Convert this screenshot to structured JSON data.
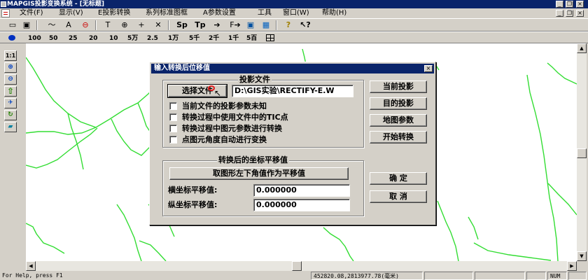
{
  "window": {
    "title": "MAPGIS投影变换系统 - [无标题]",
    "controls": [
      "_",
      "❐",
      "×"
    ]
  },
  "menubar": {
    "items": [
      "文件(F)",
      "显示(V)",
      "E投影转换",
      "系列标准图框",
      "A参数设置",
      "工具",
      "窗口(W)",
      "帮助(H)"
    ],
    "mdi_controls": [
      "_",
      "❐",
      "×"
    ]
  },
  "toolbar1": {
    "buttons": [
      {
        "icon": "new-file-icon",
        "glyph": "▭"
      },
      {
        "icon": "save-icon",
        "glyph": "▣"
      },
      {
        "icon": "polyline-icon",
        "glyph": "〜"
      },
      {
        "icon": "text-icon",
        "glyph": "A"
      },
      {
        "icon": "polygon-icon",
        "glyph": "⊖"
      },
      {
        "icon": "projection-t-icon",
        "glyph": "T"
      },
      {
        "icon": "crosshair-icon",
        "glyph": "⊕"
      },
      {
        "icon": "plus-icon",
        "glyph": "+"
      },
      {
        "icon": "x-cross-icon",
        "glyph": "✕"
      },
      {
        "icon": "sp-icon",
        "glyph": "Sp"
      },
      {
        "icon": "tp-icon",
        "glyph": "Tp"
      },
      {
        "icon": "arrow-right-icon",
        "glyph": "➔"
      },
      {
        "icon": "f-arrow-icon",
        "glyph": "F➔"
      },
      {
        "icon": "screen-icon",
        "glyph": "▣"
      },
      {
        "icon": "hatch-icon",
        "glyph": "▦"
      },
      {
        "icon": "help-icon",
        "glyph": "?"
      },
      {
        "icon": "context-help-icon",
        "glyph": "↖?"
      }
    ]
  },
  "toolbar2": {
    "scales": [
      "100",
      "50",
      "25",
      "20",
      "10",
      "5万",
      "2.5",
      "1万",
      "5千",
      "2千",
      "1千",
      "5百"
    ]
  },
  "lefttools": {
    "buttons": [
      {
        "icon": "one-to-one-icon",
        "glyph": "1:1"
      },
      {
        "icon": "zoom-in-icon",
        "glyph": "⊕"
      },
      {
        "icon": "zoom-out-icon",
        "glyph": "⊖"
      },
      {
        "icon": "move-up-icon",
        "glyph": "⇧"
      },
      {
        "icon": "pan-icon",
        "glyph": "✈"
      },
      {
        "icon": "refresh-icon",
        "glyph": "↻"
      },
      {
        "icon": "eraser-icon",
        "glyph": "▰"
      }
    ]
  },
  "statusbar": {
    "help": "For Help, press F1",
    "coords": "452820.08,2813977.78(毫米)",
    "num": "NUM"
  },
  "dialog": {
    "title": "输入转换后位移值",
    "close": "×",
    "projection_group": "投影文件",
    "select_file_button": "选择文件",
    "file_path": "D:\\GIS实验\\RECTIFY-E.W",
    "options": [
      {
        "label": "当前文件的投影参数未知",
        "checked": false
      },
      {
        "label": "转换过程中使用文件中的TIC点",
        "checked": false
      },
      {
        "label": "转换过程中图元参数进行转换",
        "checked": false
      },
      {
        "label": "点图元角度自动进行变换",
        "checked": false
      }
    ],
    "right_buttons": [
      "当前投影",
      "目的投影",
      "地图参数",
      "开始转换"
    ],
    "offset_group": "转换后的坐标平移值",
    "take_button": "取图形左下角值作为平移值",
    "x_label": "横坐标平移值:",
    "x_value": "0.000000",
    "y_label": "纵坐标平移值:",
    "y_value": "0.000000",
    "ok": "确 定",
    "cancel": "取 消"
  },
  "colors": {
    "title_bar": "#0a246a",
    "map_lines": "#33dd33",
    "face": "#d4d0c8"
  }
}
